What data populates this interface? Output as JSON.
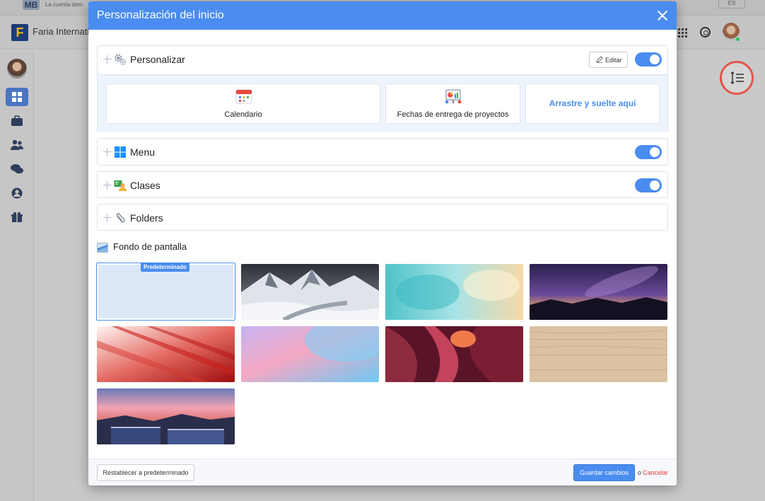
{
  "background": {
    "topbar_text": "La cuenta dem",
    "topbar_logo": "MB",
    "topbar_lang": "ES",
    "header_logo": "F",
    "header_name": "Faria Internatio",
    "layout_button_icon": "line-spacing-icon"
  },
  "modal": {
    "title": "Personalización del inicio",
    "sections": [
      {
        "label": "Personalizar",
        "icon": "gears-icon",
        "edit_label": "Editar",
        "enabled": true
      },
      {
        "label": "Menu",
        "icon": "windows-icon",
        "enabled": true
      },
      {
        "label": "Clases",
        "icon": "classroom-icon",
        "enabled": true
      },
      {
        "label": "Folders",
        "icon": "paperclip-icon"
      }
    ],
    "cards": [
      {
        "label": "Calendario",
        "icon": "calendar-icon"
      },
      {
        "label": "Fechas de entrega de proyectos",
        "icon": "project-board-icon"
      },
      {
        "label": "Arrastre y suelte aquí"
      }
    ],
    "wallpaper": {
      "title": "Fondo de pantalla",
      "default_badge": "Predeterminado",
      "options": [
        "default",
        "snowy-mountain",
        "turquoise-watercolor",
        "purple-night-sky",
        "red-streaks",
        "pastel-gradient",
        "red-canyon",
        "light-wood",
        "sunset-waterfalls"
      ],
      "selected": "default"
    },
    "footer": {
      "reset_label": "Restablecer a predeterminado",
      "save_label": "Guardar cambios",
      "or_text": "o",
      "cancel_label": "Cancelar"
    }
  },
  "colors": {
    "accent": "#4a8cf0",
    "cancel": "#e53935",
    "highlight_ring": "#e2574c"
  }
}
